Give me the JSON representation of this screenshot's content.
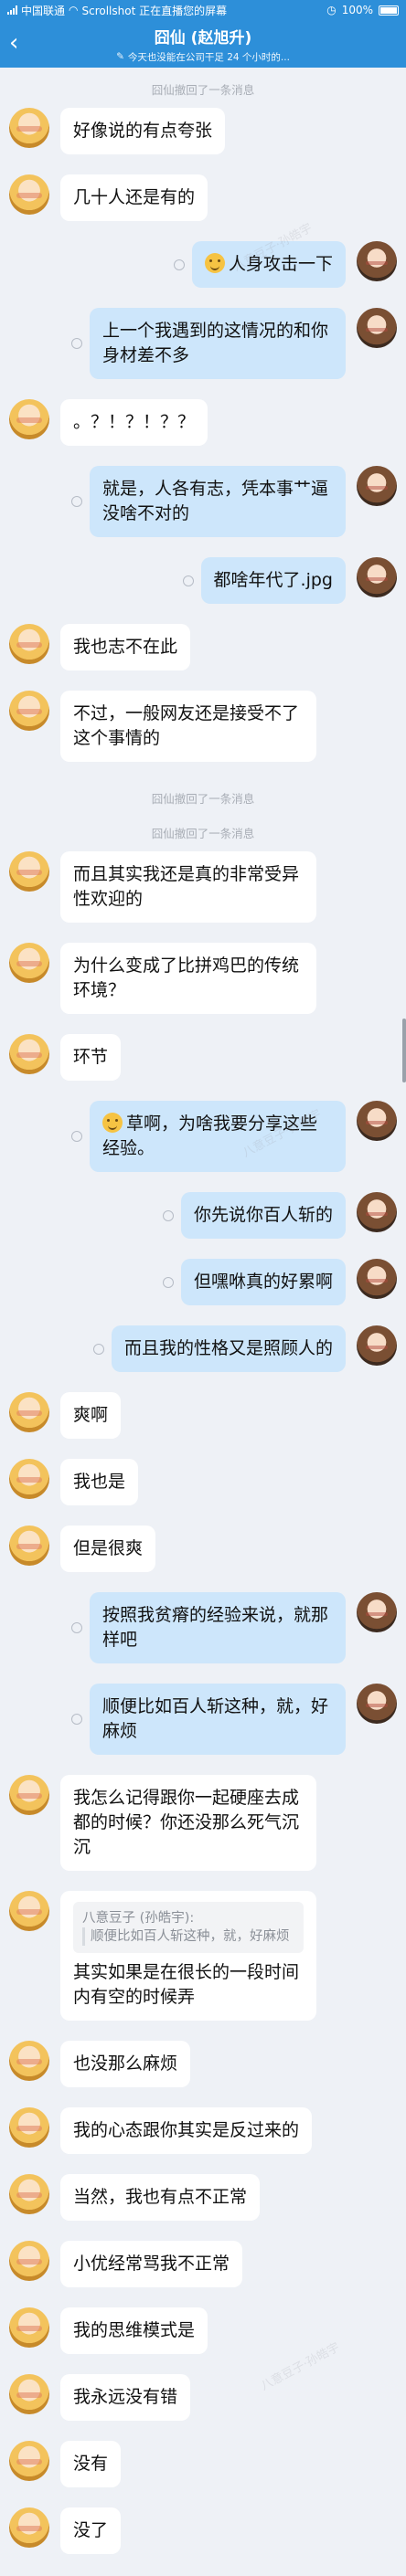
{
  "status_bar": {
    "carrier": "中国联通",
    "notice": "Scrollshot 正在直播您的屏幕",
    "battery": "100%"
  },
  "header": {
    "title": "囧仙 (赵旭升)",
    "subtitle": "今天也没能在公司干足 24 个小时的..."
  },
  "system_texts": {
    "recall": "囧仙撤回了一条消息"
  },
  "messages": [
    {
      "side": "left",
      "text": "好像说的有点夸张"
    },
    {
      "side": "left",
      "text": "几十人还是有的"
    },
    {
      "side": "right",
      "emoji": true,
      "text": "人身攻击一下"
    },
    {
      "side": "right",
      "text": "上一个我遇到的这情况的和你身材差不多"
    },
    {
      "side": "left",
      "text": "。？！？！？？"
    },
    {
      "side": "right",
      "text": "就是，人各有志，凭本事艹逼没啥不对的"
    },
    {
      "side": "right",
      "text": "都啥年代了.jpg"
    },
    {
      "side": "left",
      "text": "我也志不在此"
    },
    {
      "side": "left",
      "text": "不过，一般网友还是接受不了这个事情的"
    },
    {
      "side": "left",
      "text": "而且其实我还是真的非常受异性欢迎的"
    },
    {
      "side": "left",
      "text": "为什么变成了比拼鸡巴的传统环境？"
    },
    {
      "side": "left",
      "text": "环节"
    },
    {
      "side": "right",
      "emoji": true,
      "text": "草啊，为啥我要分享这些经验。"
    },
    {
      "side": "right",
      "text": "你先说你百人斩的"
    },
    {
      "side": "right",
      "text": "但嘿咻真的好累啊"
    },
    {
      "side": "right",
      "text": "而且我的性格又是照顾人的"
    },
    {
      "side": "left",
      "text": "爽啊"
    },
    {
      "side": "left",
      "text": "我也是"
    },
    {
      "side": "left",
      "text": "但是很爽"
    },
    {
      "side": "right",
      "text": "按照我贫瘠的经验来说，就那样吧"
    },
    {
      "side": "right",
      "text": "顺便比如百人斩这种，就，好麻烦"
    },
    {
      "side": "left",
      "text": "我怎么记得跟你一起硬座去成都的时候？你还没那么死气沉沉"
    },
    {
      "side": "left",
      "quote_author": "八意豆子 (孙皓宇):",
      "quote_text": "顺便比如百人斩这种，就，好麻烦",
      "text": "其实如果是在很长的一段时间内有空的时候弄"
    },
    {
      "side": "left",
      "text": "也没那么麻烦"
    },
    {
      "side": "left",
      "text": "我的心态跟你其实是反过来的"
    },
    {
      "side": "left",
      "text": "当然，我也有点不正常"
    },
    {
      "side": "left",
      "text": "小优经常骂我不正常"
    },
    {
      "side": "left",
      "text": "我的思维模式是"
    },
    {
      "side": "left",
      "text": "我永远没有错"
    },
    {
      "side": "left",
      "text": "没有"
    },
    {
      "side": "left",
      "text": "没了"
    }
  ]
}
